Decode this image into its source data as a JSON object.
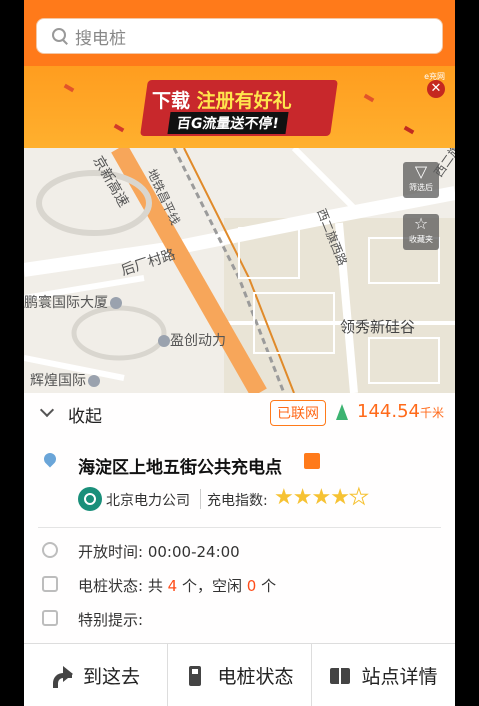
{
  "search": {
    "placeholder": "搜电桩"
  },
  "banner": {
    "line1_a": "下载",
    "line1_b": "注册有好礼",
    "line2": "百G流量送不停!",
    "ad_tag": "e充网"
  },
  "map": {
    "labels": {
      "road_1": "京新高速",
      "road_2": "地铁昌平线",
      "road_3": "后厂村路",
      "road_4": "西二旗西路",
      "road_5": "西二旗",
      "poi_1": "鹏寰国际大厦",
      "poi_2": "盈创动力",
      "poi_3": "辉煌国际",
      "area_1": "领秀新硅谷"
    },
    "tools": {
      "filter": "筛选后",
      "favorites": "收藏夹"
    }
  },
  "panel": {
    "collapse_label": "收起",
    "connected_badge": "已联网",
    "distance_value": "144.54",
    "distance_unit": "千米",
    "station_name": "海淀区上地五街公共充电点",
    "operator": "北京电力公司",
    "rating_label": "充电指数:",
    "rating": 4,
    "rating_max": 5,
    "hours_label": "开放时间:",
    "hours_value": "00:00-24:00",
    "status_label": "电桩状态:",
    "status_prefix": "共",
    "status_total": "4",
    "status_mid": "个，空闲",
    "status_free": "0",
    "status_suffix": "个",
    "tip_label": "特别提示:"
  },
  "bottom_bar": {
    "go_label": "到这去",
    "status_label": "电桩状态",
    "detail_label": "站点详情"
  },
  "colors": {
    "accent": "#ff7a1a",
    "highlight": "#ff4d1a",
    "nav_green": "#3cb371",
    "star": "#f6c233"
  }
}
